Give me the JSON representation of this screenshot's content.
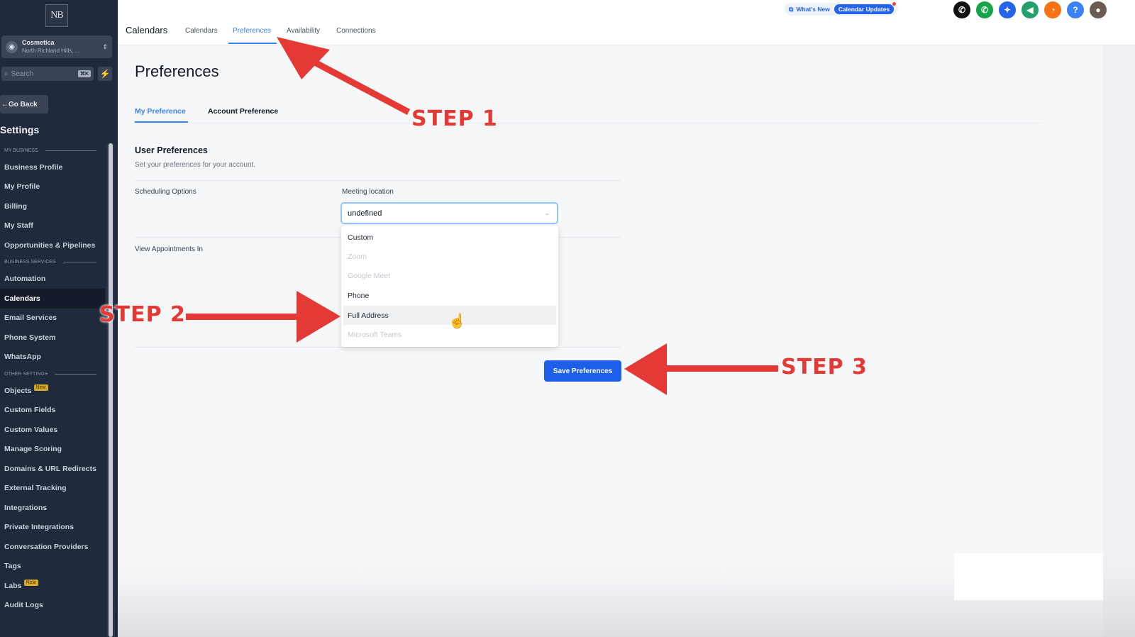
{
  "sidebar": {
    "logo": "NB",
    "account_name": "Cosmetica",
    "account_location": "North Richland Hills, ...",
    "search_placeholder": "Search",
    "search_shortcut": "⌘K",
    "go_back": "Go Back",
    "settings_title": "Settings",
    "sections": [
      {
        "label": "MY BUSINESS",
        "items": [
          "Business Profile",
          "My Profile",
          "Billing",
          "My Staff",
          "Opportunities & Pipelines"
        ]
      },
      {
        "label": "BUSINESS SERVICES",
        "items": [
          "Automation",
          "Calendars",
          "Email Services",
          "Phone System",
          "WhatsApp"
        ]
      },
      {
        "label": "OTHER SETTINGS",
        "items": [
          "Objects",
          "Custom Fields",
          "Custom Values",
          "Manage Scoring",
          "Domains & URL Redirects",
          "External Tracking",
          "Integrations",
          "Private Integrations",
          "Conversation Providers",
          "Tags",
          "Labs",
          "Audit Logs"
        ]
      }
    ],
    "active_item": "Calendars",
    "new_badge": "New"
  },
  "topbar": {
    "title": "Calendars",
    "tabs": [
      "Calendars",
      "Preferences",
      "Availability",
      "Connections"
    ],
    "active_tab": "Preferences",
    "whats_new": "What's New",
    "calendar_updates": "Calendar Updates",
    "icons": [
      {
        "name": "phone-icon",
        "color": "#111111",
        "glyph": "✆"
      },
      {
        "name": "call-icon",
        "color": "#16a34a",
        "glyph": "✆"
      },
      {
        "name": "magic-icon",
        "color": "#2563eb",
        "glyph": "✦"
      },
      {
        "name": "megaphone-icon",
        "color": "#22a06b",
        "glyph": "📣"
      },
      {
        "name": "bell-icon",
        "color": "#f97316",
        "glyph": "🔔"
      },
      {
        "name": "help-icon",
        "color": "#3b82f6",
        "glyph": "?"
      }
    ]
  },
  "main": {
    "page_title": "Preferences",
    "subtabs": [
      "My Preference",
      "Account Preference"
    ],
    "section_title": "User Preferences",
    "section_subtitle": "Set your preferences for your account.",
    "scheduling_label": "Scheduling Options",
    "meeting_location_label": "Meeting location",
    "meeting_location_value": "undefined",
    "view_appointments_label": "View Appointments In",
    "dropdown_options": [
      {
        "label": "Custom",
        "disabled": false
      },
      {
        "label": "Zoom",
        "disabled": true
      },
      {
        "label": "Google Meet",
        "disabled": true
      },
      {
        "label": "Phone",
        "disabled": false
      },
      {
        "label": "Full Address",
        "disabled": false,
        "hovered": true
      },
      {
        "label": "Microsoft Teams",
        "disabled": true
      }
    ],
    "save_button": "Save Preferences"
  },
  "annotations": {
    "step1": "STEP 1",
    "step2": "STEP 2",
    "step3": "STEP 3",
    "color": "#e53935"
  }
}
